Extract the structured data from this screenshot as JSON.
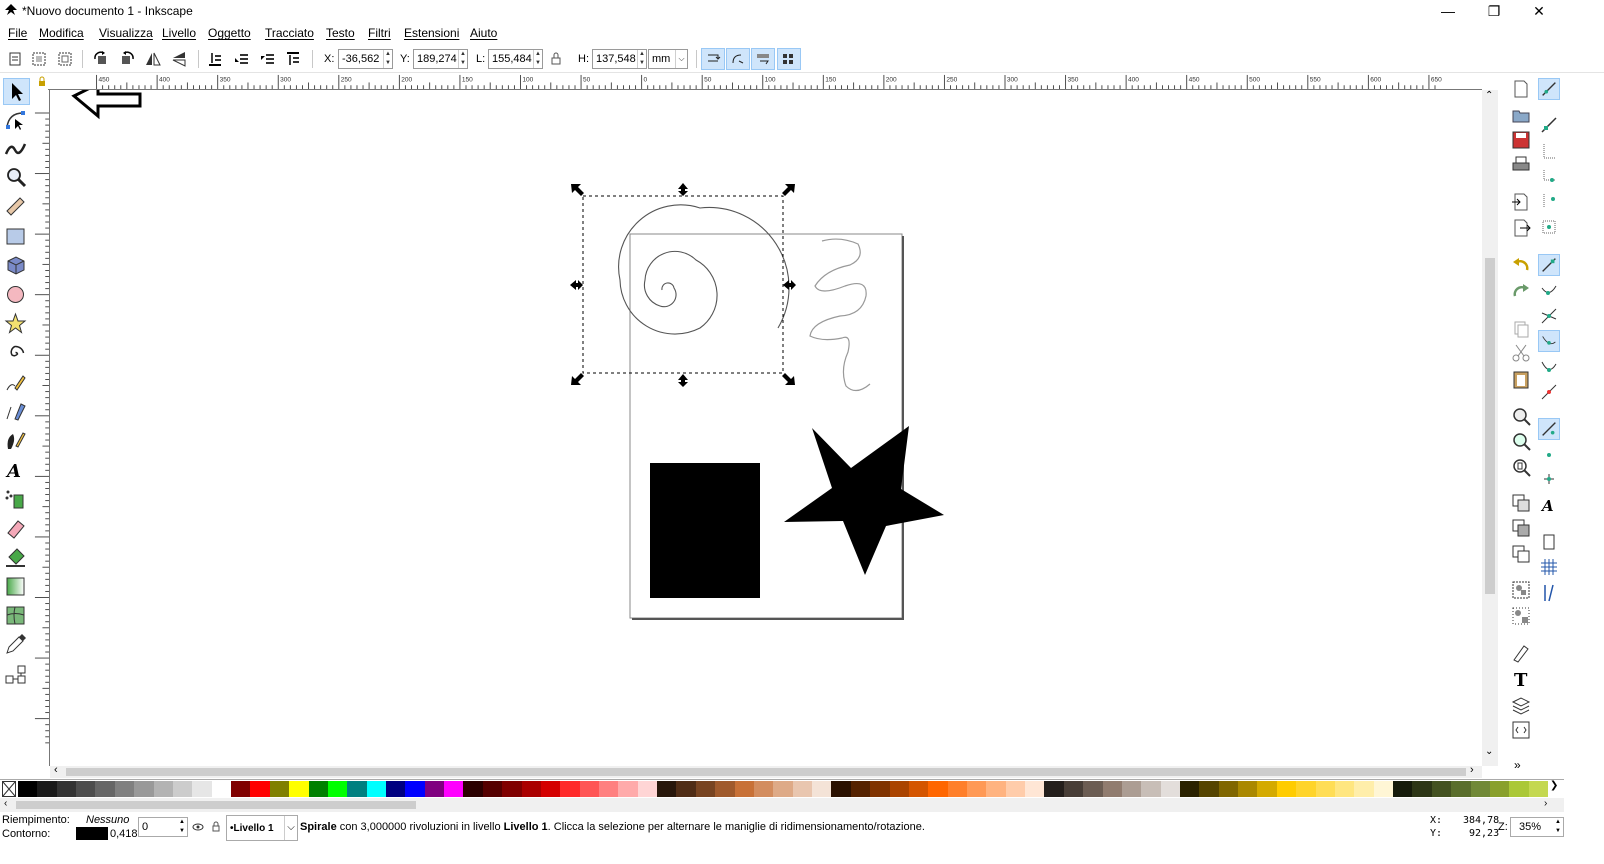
{
  "window": {
    "title": "*Nuovo documento 1 - Inkscape",
    "minimize": "—",
    "maximize": "❐",
    "close": "✕"
  },
  "menu": [
    "File",
    "Modifica",
    "Visualizza",
    "Livello",
    "Oggetto",
    "Tracciato",
    "Testo",
    "Filtri",
    "Estensioni",
    "Aiuto"
  ],
  "toolbar": {
    "x_label": "X:",
    "x_value": "-36,562",
    "y_label": "Y:",
    "y_value": "189,274",
    "w_label": "L:",
    "w_value": "155,484",
    "h_label": "H:",
    "h_value": "137,548",
    "unit": "mm"
  },
  "ruler": {
    "h_ticks": [
      "450",
      "400",
      "350",
      "300",
      "250",
      "200",
      "150",
      "100",
      "50",
      "0",
      "50",
      "100",
      "150",
      "200",
      "250",
      "300",
      "350",
      "400",
      "450",
      "500",
      "550",
      "600",
      "650"
    ]
  },
  "tools": [
    "selector-tool",
    "node-tool",
    "tweak-tool",
    "zoom-tool",
    "measure-tool",
    "rectangle-tool",
    "3d-box-tool",
    "ellipse-tool",
    "star-tool",
    "spiral-tool",
    "pencil-tool",
    "pen-tool",
    "calligraphy-tool",
    "text-tool",
    "spray-tool",
    "eraser-tool",
    "paint-bucket-tool",
    "gradient-tool",
    "mesh-tool",
    "dropper-tool",
    "connector-tool"
  ],
  "colors": {
    "accent_bg": "#cfe5fb",
    "accent_border": "#99c8f5",
    "shape_fill": "#000000"
  },
  "status": {
    "fill_label": "Riempimento:",
    "fill_value": "Nessuno",
    "stroke_label": "Contorno:",
    "stroke_width": "0,418",
    "opacity_value": "0",
    "layer": "•Livello 1",
    "message_strong": "Spirale",
    "message_mid": " con 3,000000 rivoluzioni in livello ",
    "message_layer": "Livello 1",
    "message_end": ". Clicca la selezione per alternare le maniglie di ridimensionamento/rotazione.",
    "x_label": "X:",
    "x_coord": "384,78",
    "y_label": "Y:",
    "y_coord": "92,23",
    "zoom_label": "Z:",
    "zoom_value": "35%"
  }
}
